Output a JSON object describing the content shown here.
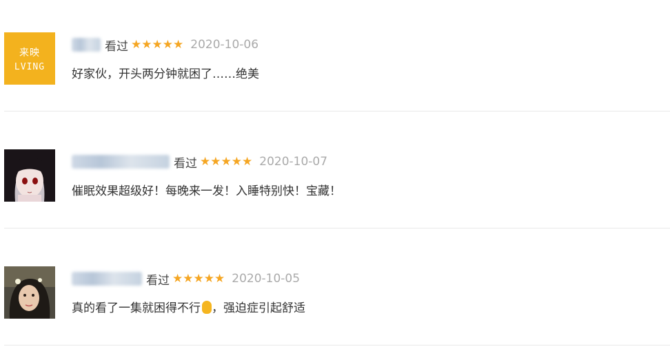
{
  "reviews": [
    {
      "avatar": {
        "type": "logo",
        "cn": "来映",
        "en": "LVING",
        "color": "#f3b21e"
      },
      "watched": "看过",
      "rating": 5,
      "date": "2020-10-06",
      "comment": "好家伙，开头两分钟就困了……绝美"
    },
    {
      "avatar": {
        "type": "photo",
        "description": "anime-girl"
      },
      "watched": "看过",
      "rating": 5,
      "date": "2020-10-07",
      "comment": "催眠效果超级好！每晚来一发！入睡特别快！宝藏！"
    },
    {
      "avatar": {
        "type": "photo",
        "description": "person"
      },
      "watched": "看过",
      "rating": 5,
      "date": "2020-10-05",
      "comment": "真的看了一集就困得不行",
      "comment_suffix": "，强迫症引起舒适",
      "emoji": "hand-emoji"
    }
  ],
  "star_glyph": "★",
  "colors": {
    "star": "#f5a623",
    "date": "#aaaaaa",
    "divider": "#e8e8e8"
  }
}
